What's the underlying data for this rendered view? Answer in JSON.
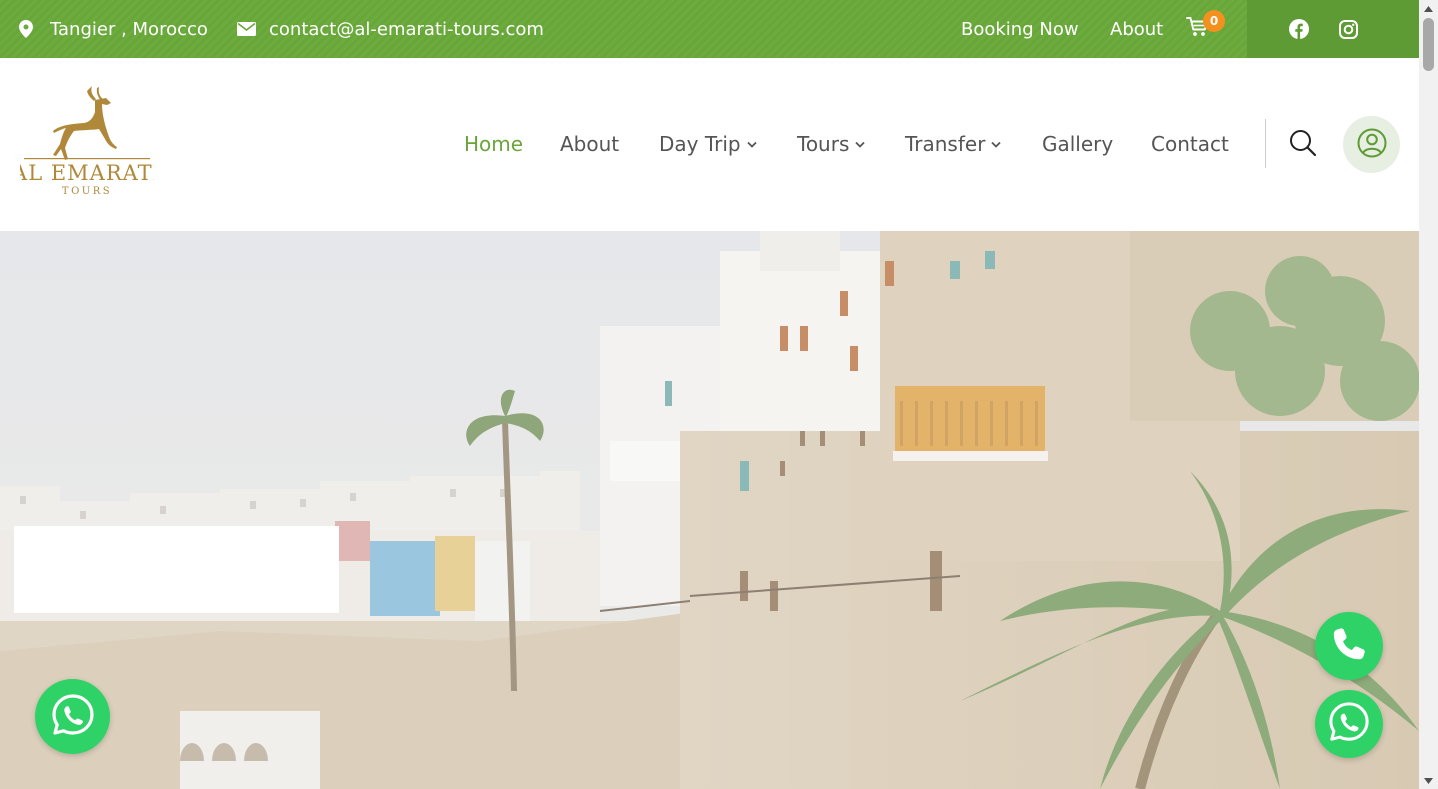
{
  "topbar": {
    "location_icon": "map-pin-icon",
    "location": "Tangier , Morocco",
    "email_icon": "envelope-icon",
    "email": "contact@al-emarati-tours.com",
    "booking_label": "Booking Now",
    "about_label": "About",
    "cart_icon": "shopping-cart-icon",
    "cart_count": "0",
    "social": [
      "facebook-icon",
      "instagram-icon"
    ],
    "bg_color": "#6cab3d",
    "badge_color": "#f4901e"
  },
  "brand": {
    "logo_icon": "gazelle-logo",
    "name": "AL EMARATI",
    "tagline": "TOURS",
    "color": "#b0883a"
  },
  "nav": {
    "items": [
      {
        "label": "Home",
        "active": true
      },
      {
        "label": "About"
      },
      {
        "label": "Day Trip",
        "dropdown": true
      },
      {
        "label": "Tours",
        "dropdown": true
      },
      {
        "label": "Transfer",
        "dropdown": true
      },
      {
        "label": "Gallery"
      },
      {
        "label": "Contact"
      }
    ],
    "active_color": "#6aa53b",
    "search_icon": "search-icon",
    "user_icon": "user-circle-icon"
  },
  "hero": {
    "image": "tangier-kasbah-photo"
  },
  "floating": {
    "whatsapp_left_icon": "whatsapp-icon",
    "call_icon": "phone-icon",
    "whatsapp_right_icon": "whatsapp-icon",
    "color": "#2fd266"
  }
}
